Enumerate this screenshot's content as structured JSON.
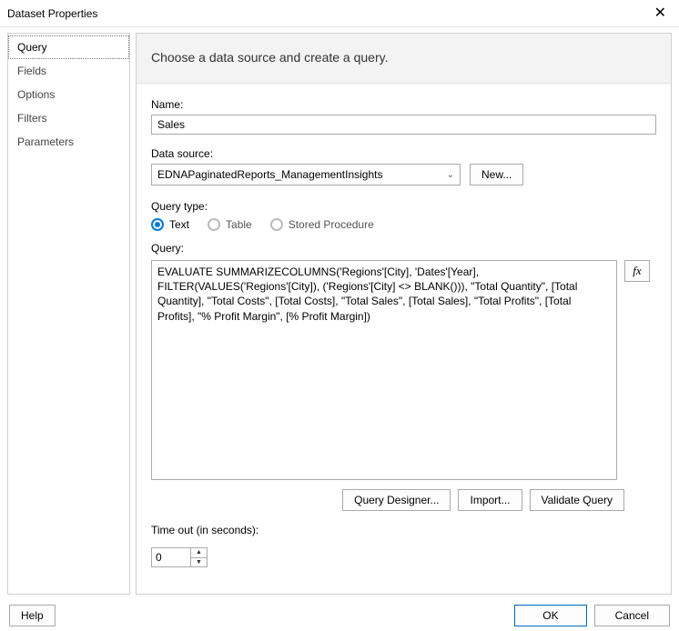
{
  "window": {
    "title": "Dataset Properties"
  },
  "sidebar": {
    "items": [
      {
        "label": "Query"
      },
      {
        "label": "Fields"
      },
      {
        "label": "Options"
      },
      {
        "label": "Filters"
      },
      {
        "label": "Parameters"
      }
    ]
  },
  "header": {
    "text": "Choose a data source and create a query."
  },
  "form": {
    "name_label": "Name:",
    "name_value": "Sales",
    "datasource_label": "Data source:",
    "datasource_value": "EDNAPaginatedReports_ManagementInsights",
    "new_btn": "New...",
    "querytype_label": "Query type:",
    "querytype_options": {
      "text": "Text",
      "table": "Table",
      "stored": "Stored Procedure"
    },
    "query_label": "Query:",
    "query_value": "EVALUATE SUMMARIZECOLUMNS('Regions'[City], 'Dates'[Year], FILTER(VALUES('Regions'[City]), ('Regions'[City] <> BLANK())), \"Total Quantity\", [Total Quantity], \"Total Costs\", [Total Costs], \"Total Sales\", [Total Sales], \"Total Profits\", [Total Profits], \"% Profit Margin\", [% Profit Margin])",
    "fx_label": "fx",
    "query_designer_btn": "Query Designer...",
    "import_btn": "Import...",
    "validate_btn": "Validate Query",
    "timeout_label": "Time out (in seconds):",
    "timeout_value": "0"
  },
  "footer": {
    "help": "Help",
    "ok": "OK",
    "cancel": "Cancel"
  }
}
